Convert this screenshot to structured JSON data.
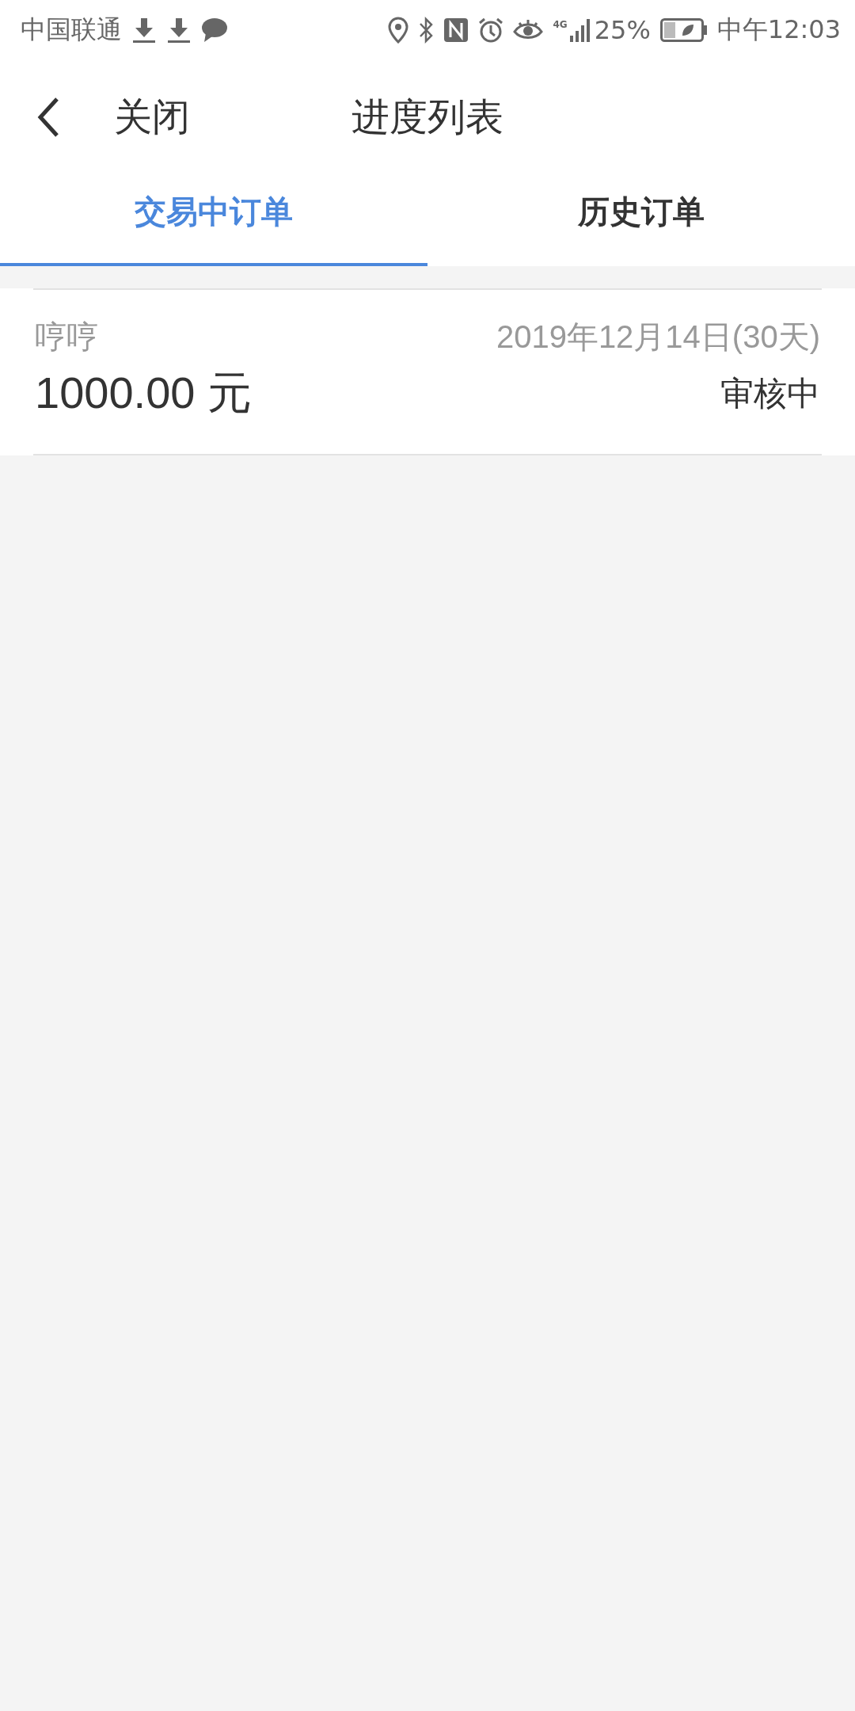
{
  "status_bar": {
    "carrier": "中国联通",
    "network": "4G",
    "battery": "25%",
    "time": "中午12:03"
  },
  "header": {
    "close": "关闭",
    "title": "进度列表"
  },
  "tabs": [
    {
      "label": "交易中订单",
      "selected": true
    },
    {
      "label": "历史订单",
      "selected": false
    }
  ],
  "orders": [
    {
      "name": "哼哼",
      "date": "2019年12月14日(30天)",
      "amount": "1000.00 元",
      "status": "审核中"
    }
  ]
}
